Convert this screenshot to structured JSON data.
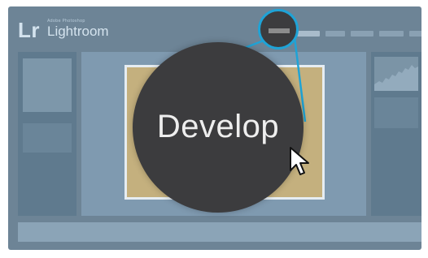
{
  "app": {
    "logo_mark": "Lr",
    "logo_small": "Adobe Photoshop",
    "logo_name": "Lightroom"
  },
  "callout": {
    "label": "Develop"
  },
  "colors": {
    "panel_bg": "#6d8496",
    "highlight_ring": "#1fa3d6",
    "callout_bg": "#3c3c3e",
    "photo": "#c4b07e"
  },
  "icons": {
    "cursor": "mouse-pointer-icon"
  }
}
